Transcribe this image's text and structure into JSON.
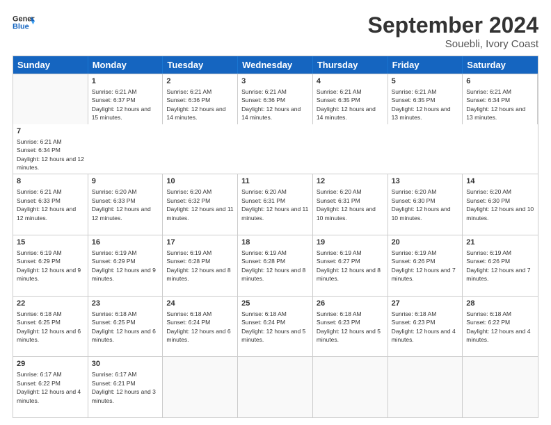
{
  "header": {
    "logo_line1": "General",
    "logo_line2": "Blue",
    "month_title": "September 2024",
    "subtitle": "Souebli, Ivory Coast"
  },
  "days": [
    "Sunday",
    "Monday",
    "Tuesday",
    "Wednesday",
    "Thursday",
    "Friday",
    "Saturday"
  ],
  "rows": [
    [
      {
        "day": "",
        "empty": true
      },
      {
        "day": "1",
        "sunrise": "Sunrise: 6:21 AM",
        "sunset": "Sunset: 6:37 PM",
        "daylight": "Daylight: 12 hours and 15 minutes."
      },
      {
        "day": "2",
        "sunrise": "Sunrise: 6:21 AM",
        "sunset": "Sunset: 6:36 PM",
        "daylight": "Daylight: 12 hours and 14 minutes."
      },
      {
        "day": "3",
        "sunrise": "Sunrise: 6:21 AM",
        "sunset": "Sunset: 6:36 PM",
        "daylight": "Daylight: 12 hours and 14 minutes."
      },
      {
        "day": "4",
        "sunrise": "Sunrise: 6:21 AM",
        "sunset": "Sunset: 6:35 PM",
        "daylight": "Daylight: 12 hours and 14 minutes."
      },
      {
        "day": "5",
        "sunrise": "Sunrise: 6:21 AM",
        "sunset": "Sunset: 6:35 PM",
        "daylight": "Daylight: 12 hours and 13 minutes."
      },
      {
        "day": "6",
        "sunrise": "Sunrise: 6:21 AM",
        "sunset": "Sunset: 6:34 PM",
        "daylight": "Daylight: 12 hours and 13 minutes."
      },
      {
        "day": "7",
        "sunrise": "Sunrise: 6:21 AM",
        "sunset": "Sunset: 6:34 PM",
        "daylight": "Daylight: 12 hours and 12 minutes."
      }
    ],
    [
      {
        "day": "8",
        "sunrise": "Sunrise: 6:21 AM",
        "sunset": "Sunset: 6:33 PM",
        "daylight": "Daylight: 12 hours and 12 minutes."
      },
      {
        "day": "9",
        "sunrise": "Sunrise: 6:20 AM",
        "sunset": "Sunset: 6:33 PM",
        "daylight": "Daylight: 12 hours and 12 minutes."
      },
      {
        "day": "10",
        "sunrise": "Sunrise: 6:20 AM",
        "sunset": "Sunset: 6:32 PM",
        "daylight": "Daylight: 12 hours and 11 minutes."
      },
      {
        "day": "11",
        "sunrise": "Sunrise: 6:20 AM",
        "sunset": "Sunset: 6:31 PM",
        "daylight": "Daylight: 12 hours and 11 minutes."
      },
      {
        "day": "12",
        "sunrise": "Sunrise: 6:20 AM",
        "sunset": "Sunset: 6:31 PM",
        "daylight": "Daylight: 12 hours and 10 minutes."
      },
      {
        "day": "13",
        "sunrise": "Sunrise: 6:20 AM",
        "sunset": "Sunset: 6:30 PM",
        "daylight": "Daylight: 12 hours and 10 minutes."
      },
      {
        "day": "14",
        "sunrise": "Sunrise: 6:20 AM",
        "sunset": "Sunset: 6:30 PM",
        "daylight": "Daylight: 12 hours and 10 minutes."
      }
    ],
    [
      {
        "day": "15",
        "sunrise": "Sunrise: 6:19 AM",
        "sunset": "Sunset: 6:29 PM",
        "daylight": "Daylight: 12 hours and 9 minutes."
      },
      {
        "day": "16",
        "sunrise": "Sunrise: 6:19 AM",
        "sunset": "Sunset: 6:29 PM",
        "daylight": "Daylight: 12 hours and 9 minutes."
      },
      {
        "day": "17",
        "sunrise": "Sunrise: 6:19 AM",
        "sunset": "Sunset: 6:28 PM",
        "daylight": "Daylight: 12 hours and 8 minutes."
      },
      {
        "day": "18",
        "sunrise": "Sunrise: 6:19 AM",
        "sunset": "Sunset: 6:28 PM",
        "daylight": "Daylight: 12 hours and 8 minutes."
      },
      {
        "day": "19",
        "sunrise": "Sunrise: 6:19 AM",
        "sunset": "Sunset: 6:27 PM",
        "daylight": "Daylight: 12 hours and 8 minutes."
      },
      {
        "day": "20",
        "sunrise": "Sunrise: 6:19 AM",
        "sunset": "Sunset: 6:26 PM",
        "daylight": "Daylight: 12 hours and 7 minutes."
      },
      {
        "day": "21",
        "sunrise": "Sunrise: 6:19 AM",
        "sunset": "Sunset: 6:26 PM",
        "daylight": "Daylight: 12 hours and 7 minutes."
      }
    ],
    [
      {
        "day": "22",
        "sunrise": "Sunrise: 6:18 AM",
        "sunset": "Sunset: 6:25 PM",
        "daylight": "Daylight: 12 hours and 6 minutes."
      },
      {
        "day": "23",
        "sunrise": "Sunrise: 6:18 AM",
        "sunset": "Sunset: 6:25 PM",
        "daylight": "Daylight: 12 hours and 6 minutes."
      },
      {
        "day": "24",
        "sunrise": "Sunrise: 6:18 AM",
        "sunset": "Sunset: 6:24 PM",
        "daylight": "Daylight: 12 hours and 6 minutes."
      },
      {
        "day": "25",
        "sunrise": "Sunrise: 6:18 AM",
        "sunset": "Sunset: 6:24 PM",
        "daylight": "Daylight: 12 hours and 5 minutes."
      },
      {
        "day": "26",
        "sunrise": "Sunrise: 6:18 AM",
        "sunset": "Sunset: 6:23 PM",
        "daylight": "Daylight: 12 hours and 5 minutes."
      },
      {
        "day": "27",
        "sunrise": "Sunrise: 6:18 AM",
        "sunset": "Sunset: 6:23 PM",
        "daylight": "Daylight: 12 hours and 4 minutes."
      },
      {
        "day": "28",
        "sunrise": "Sunrise: 6:18 AM",
        "sunset": "Sunset: 6:22 PM",
        "daylight": "Daylight: 12 hours and 4 minutes."
      }
    ],
    [
      {
        "day": "29",
        "sunrise": "Sunrise: 6:17 AM",
        "sunset": "Sunset: 6:22 PM",
        "daylight": "Daylight: 12 hours and 4 minutes."
      },
      {
        "day": "30",
        "sunrise": "Sunrise: 6:17 AM",
        "sunset": "Sunset: 6:21 PM",
        "daylight": "Daylight: 12 hours and 3 minutes."
      },
      {
        "day": "",
        "empty": true
      },
      {
        "day": "",
        "empty": true
      },
      {
        "day": "",
        "empty": true
      },
      {
        "day": "",
        "empty": true
      },
      {
        "day": "",
        "empty": true
      }
    ]
  ]
}
